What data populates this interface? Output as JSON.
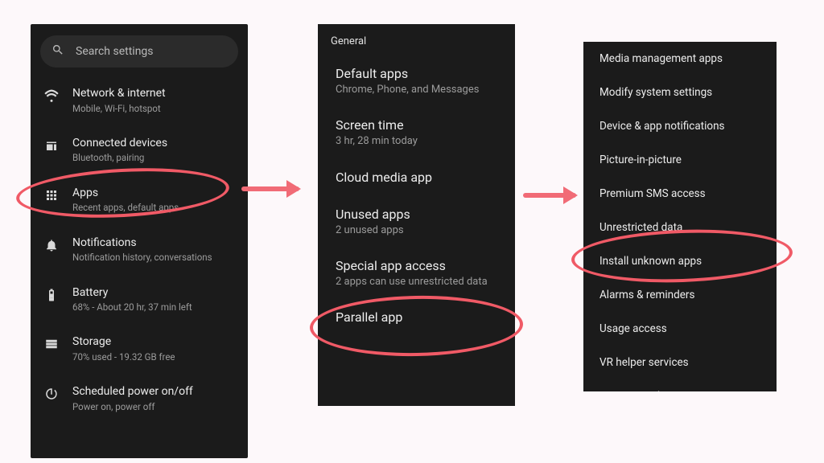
{
  "annotation_color": "#f05a66",
  "panel1": {
    "search_placeholder": "Search settings",
    "items": [
      {
        "title": "Network & internet",
        "sub": "Mobile, Wi-Fi, hotspot"
      },
      {
        "title": "Connected devices",
        "sub": "Bluetooth, pairing"
      },
      {
        "title": "Apps",
        "sub": "Recent apps, default apps"
      },
      {
        "title": "Notifications",
        "sub": "Notification history, conversations"
      },
      {
        "title": "Battery",
        "sub": "68% - About 20 hr, 37 min left"
      },
      {
        "title": "Storage",
        "sub": "70% used - 19.32 GB free"
      },
      {
        "title": "Scheduled power on/off",
        "sub": "Power on, power off"
      }
    ]
  },
  "panel2": {
    "header": "General",
    "items": [
      {
        "title": "Default apps",
        "sub": "Chrome, Phone, and Messages"
      },
      {
        "title": "Screen time",
        "sub": "3 hr, 28 min today"
      },
      {
        "title": "Cloud media app",
        "sub": ""
      },
      {
        "title": "Unused apps",
        "sub": "2 unused apps"
      },
      {
        "title": "Special app access",
        "sub": "2 apps can use unrestricted data"
      },
      {
        "title": "Parallel app",
        "sub": ""
      }
    ]
  },
  "panel3": {
    "items": [
      "Media management apps",
      "Modify system settings",
      "Device & app notifications",
      "Picture-in-picture",
      "Premium SMS access",
      "Unrestricted data",
      "Install unknown apps",
      "Alarms & reminders",
      "Usage access",
      "VR helper services",
      "Wi-Fi control"
    ]
  }
}
